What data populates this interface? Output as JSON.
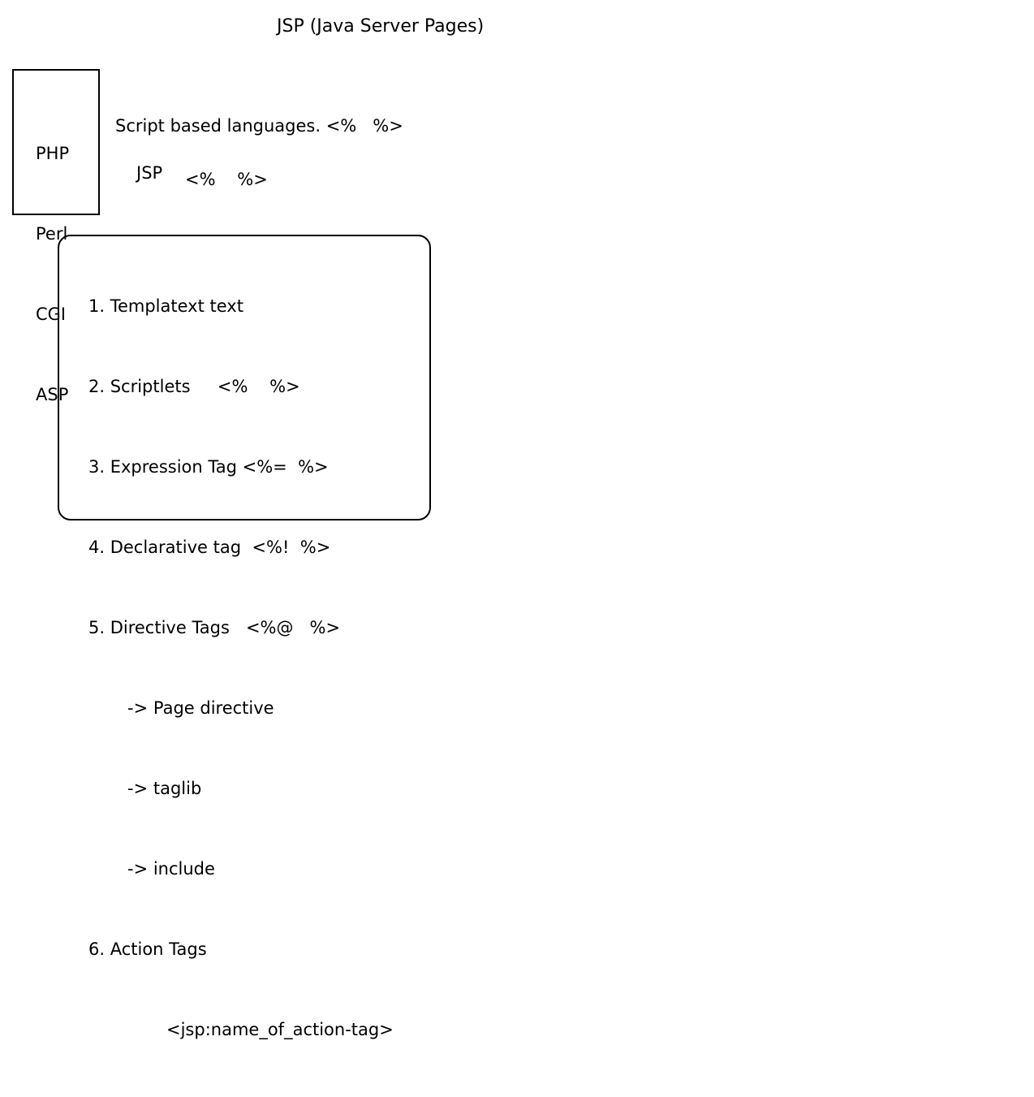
{
  "title": "JSP (Java Server Pages)",
  "languages": [
    "PHP",
    "Perl",
    "CGI",
    "ASP"
  ],
  "script_line": "Script based languages. <%   %>",
  "jsp_label": "JSP",
  "jsp_tag": "<%    %>",
  "elements": [
    "1. Templatext text",
    "2. Scriptlets     <%    %>",
    "3. Expression Tag <%=  %>",
    "4. Declarative tag  <%!  %>",
    "5. Directive Tags   <%@   %>",
    "-> Page directive",
    "-> taglib",
    "-> include",
    "6. Action Tags",
    "<jsp:name_of_action-tag>"
  ]
}
